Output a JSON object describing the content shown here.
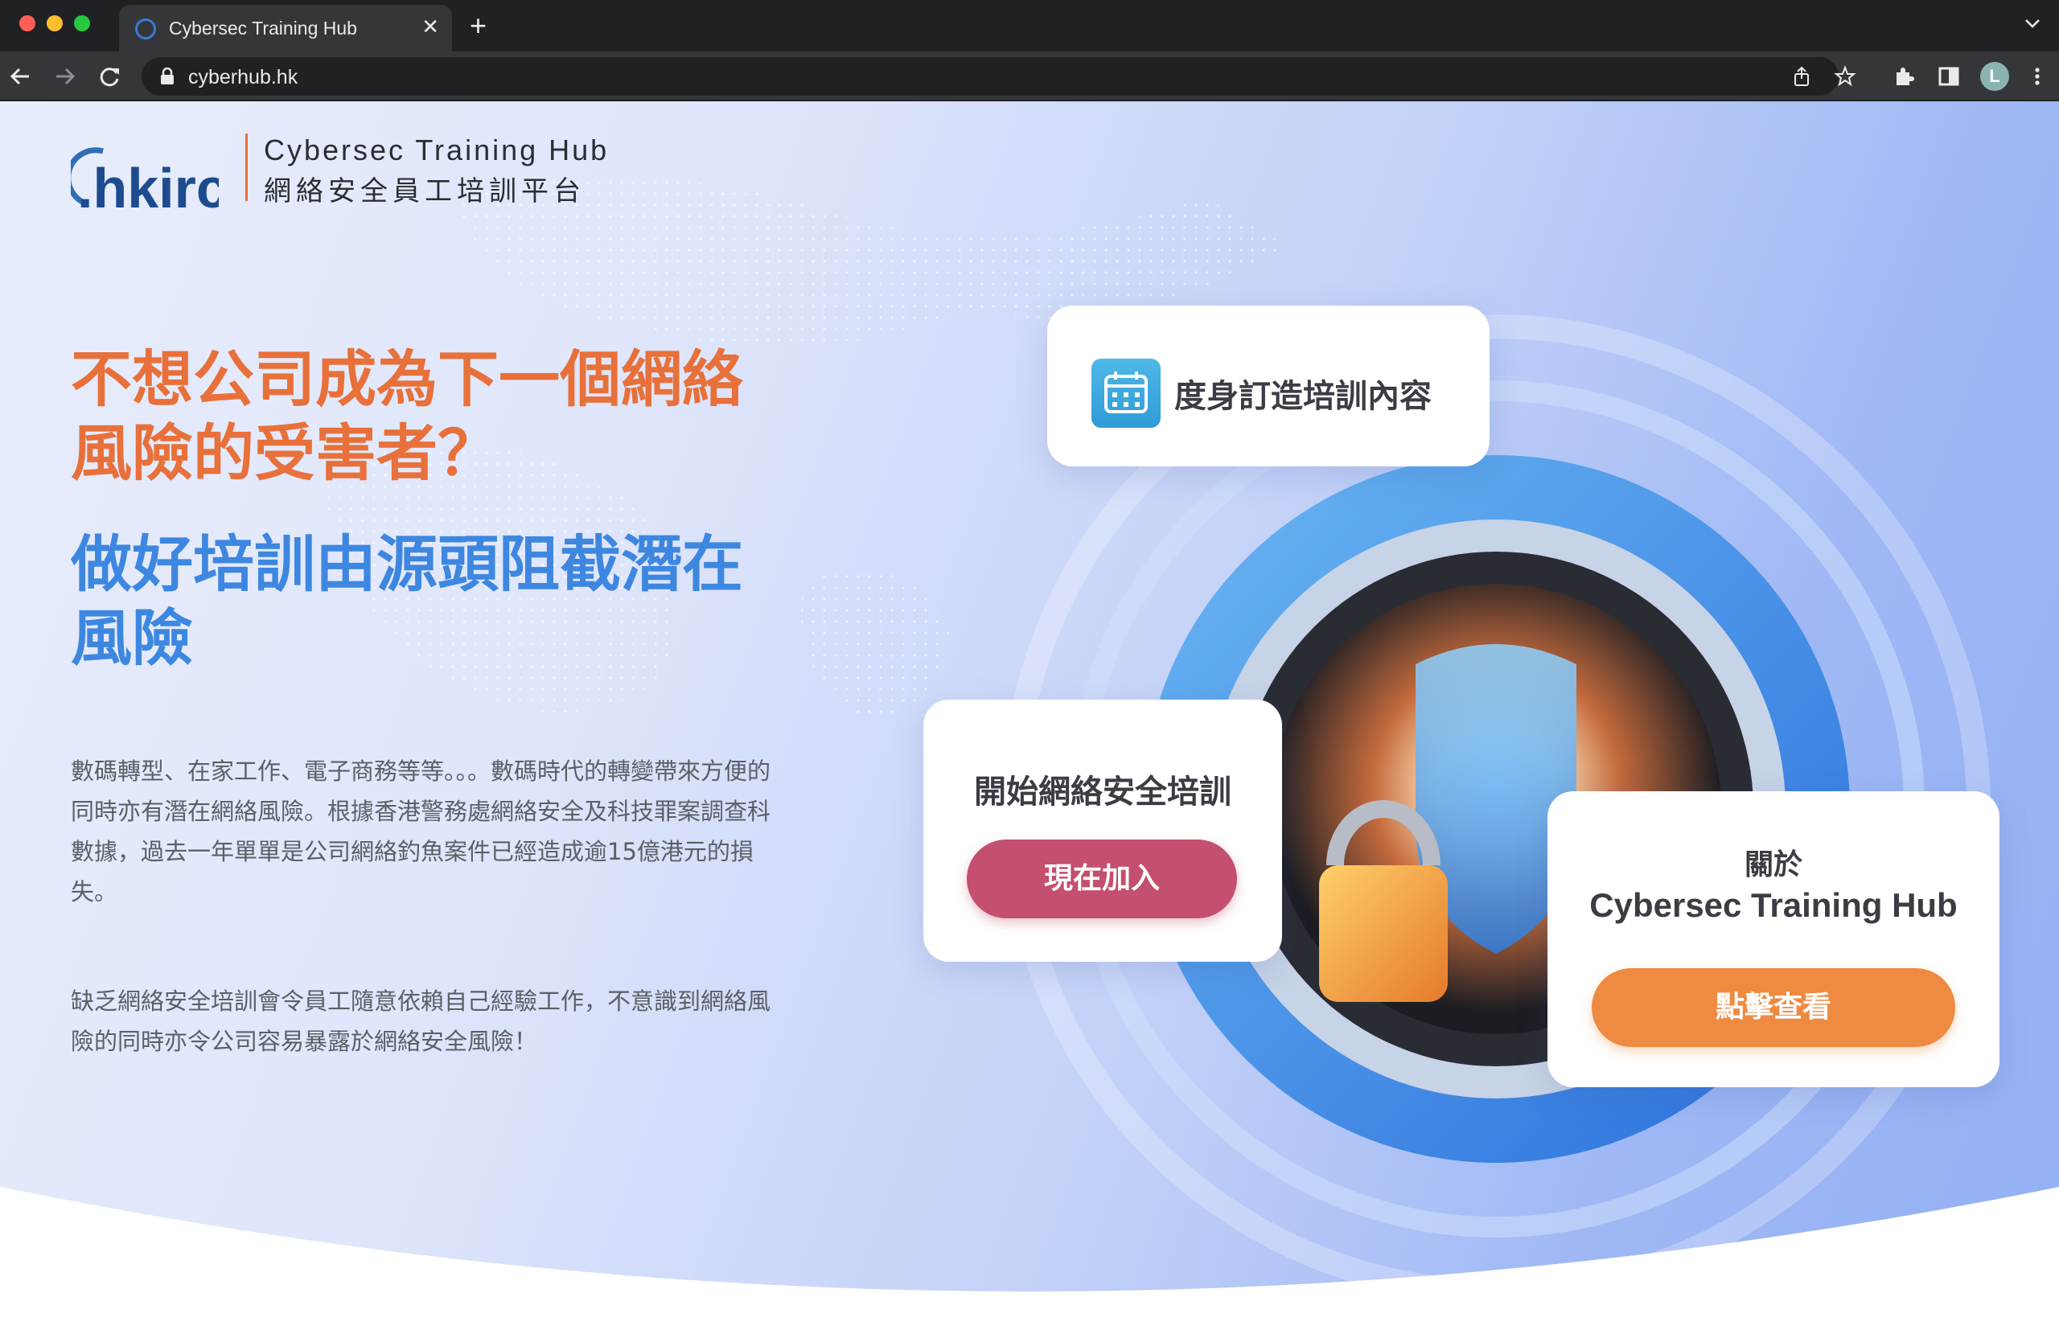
{
  "browser": {
    "tab_title": "Cybersec Training Hub",
    "tab_close": "✕",
    "new_tab": "+",
    "url": "cyberhub.hk",
    "profile_initial": "L"
  },
  "site": {
    "logo_text": ".hkirc",
    "brand_en": "Cybersec Training Hub",
    "brand_zh": "網絡安全員工培訓平台"
  },
  "hero": {
    "headline_orange": "不想公司成為下一個網絡風險的受害者？",
    "headline_blue": "做好培訓由源頭阻截潛在風險",
    "paragraph_1": "數碼轉型、在家工作、電子商務等等。。。數碼時代的轉變帶來方便的同時亦有潛在網絡風險。根據香港警務處網絡安全及科技罪案調查科數據，過去一年單單是公司網絡釣魚案件已經造成逾15億港元的損失。",
    "paragraph_2": "缺乏網絡安全培訓會令員工隨意依賴自己經驗工作，不意識到網絡風險的同時亦令公司容易暴露於網絡安全風險！"
  },
  "cards": {
    "custom_training": "度身訂造培訓內容",
    "start_title": "開始網絡安全培訓",
    "join_button": "現在加入",
    "about_title": "關於",
    "about_subtitle": "Cybersec Training Hub",
    "view_button": "點擊查看"
  },
  "colors": {
    "orange": "#e8703a",
    "blue": "#3d87e0",
    "join_button": "#c44f6e",
    "view_button": "#ee8a42"
  }
}
